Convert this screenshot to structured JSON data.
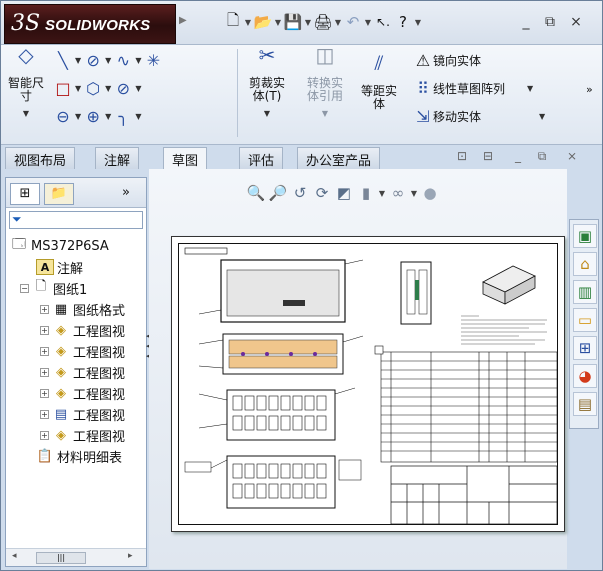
{
  "app": {
    "brand_mark": "3S",
    "brand_name": "SOLIDWORKS"
  },
  "colors": {
    "logo_bg": "#3c1414",
    "ribbon": "#e8eef6",
    "accent": "#1a5cb8"
  },
  "quick_access": {
    "icons": [
      "new-icon",
      "open-icon",
      "save-icon",
      "print-icon",
      "undo-icon",
      "select-icon",
      "help-icon"
    ]
  },
  "window_controls": {
    "minimize": "_",
    "restore": "⧉",
    "close": "⨯"
  },
  "ribbon": {
    "smart_dim": "智能尺\n寸",
    "trim": "剪裁实\n体(T)",
    "convert": "转换实\n体引用",
    "offset": "等距实\n体",
    "mirror": "镜向实体",
    "linear_pattern": "线性草图阵列",
    "move": "移动实体"
  },
  "tabs": [
    {
      "label": "视图布局"
    },
    {
      "label": "注解"
    },
    {
      "label": "草图"
    },
    {
      "label": "评估"
    },
    {
      "label": "办公室产品"
    }
  ],
  "feature_tree": {
    "more": "»",
    "root": "MS372P6SA",
    "annotations": "注解",
    "sheet": "图纸1",
    "sheet_format": "图纸格式",
    "drawing_view": "工程图视",
    "bom": "材料明细表"
  }
}
